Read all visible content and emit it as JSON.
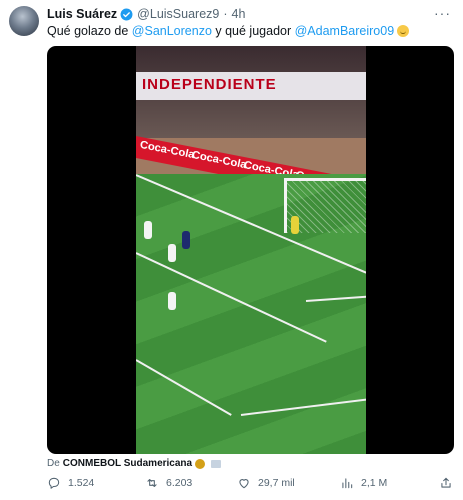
{
  "author": {
    "name": "Luis Suárez",
    "handle": "@LuisSuarez9",
    "separator": "·",
    "time": "4h",
    "more": "···"
  },
  "tweet": {
    "text_1": "Qué golazo de ",
    "mention_1": "@SanLorenzo",
    "text_2": " y qué jugador ",
    "mention_2": "@AdamBareiro09"
  },
  "media": {
    "banner_text": "INDEPENDIENTE",
    "ad_text": "Coca-Cola"
  },
  "attribution": {
    "prefix": "De",
    "source": "CONMEBOL Sudamericana"
  },
  "actions": {
    "replies": "1.524",
    "reposts": "6.203",
    "likes": "29,7 mil",
    "views": "2,1 M"
  },
  "colors": {
    "link": "#1d9bf0",
    "verified": "#1d9bf0",
    "muted": "#536471"
  }
}
